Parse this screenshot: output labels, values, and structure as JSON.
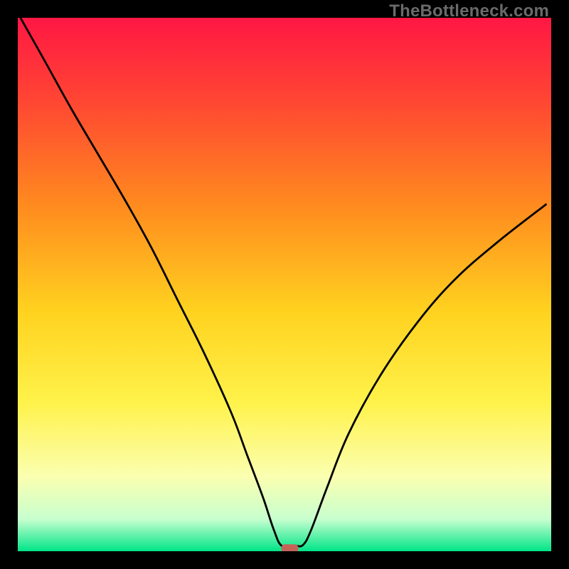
{
  "watermark": "TheBottleneck.com",
  "chart_data": {
    "type": "line",
    "title": "",
    "xlabel": "",
    "ylabel": "",
    "xlim": [
      0,
      100
    ],
    "ylim": [
      0,
      100
    ],
    "grid": false,
    "legend": false,
    "background_gradient": {
      "stops": [
        {
          "pos": 0.0,
          "color": "#ff1744"
        },
        {
          "pos": 0.15,
          "color": "#ff4433"
        },
        {
          "pos": 0.35,
          "color": "#ff8a1f"
        },
        {
          "pos": 0.55,
          "color": "#ffd21f"
        },
        {
          "pos": 0.72,
          "color": "#fff24a"
        },
        {
          "pos": 0.86,
          "color": "#fbffb0"
        },
        {
          "pos": 0.94,
          "color": "#c7ffcf"
        },
        {
          "pos": 1.0,
          "color": "#00e588"
        }
      ]
    },
    "series": [
      {
        "name": "bottleneck-curve",
        "stroke": "#000000",
        "width": 2.8,
        "x": [
          0.5,
          5,
          10,
          15,
          20,
          25,
          30,
          35,
          40,
          43,
          46,
          48,
          49.5,
          52,
          53.5,
          55,
          58,
          62,
          68,
          75,
          82,
          90,
          99
        ],
        "y": [
          100,
          92,
          83,
          74.5,
          66,
          57,
          47,
          37,
          26,
          18,
          10,
          4,
          1,
          1,
          1.2,
          4,
          12,
          22,
          33,
          43,
          51,
          58,
          65
        ]
      }
    ],
    "marker": {
      "name": "optimal-point",
      "shape": "rounded-rect",
      "x": 51,
      "y": 0.5,
      "w": 3.2,
      "h": 1.6,
      "fill": "#c46357"
    }
  }
}
